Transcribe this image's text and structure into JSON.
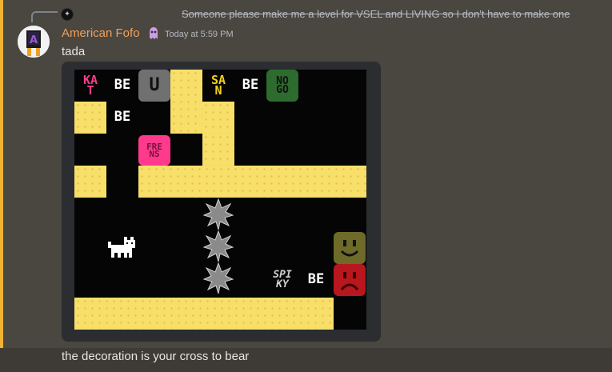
{
  "reply": {
    "text": "Someone please make me a level for VSEL and LIVING so I don't have to make one"
  },
  "message": {
    "author": "American Fofo",
    "timestamp": "Today at 5:59 PM",
    "content": "tada"
  },
  "game": {
    "words": {
      "kat": "KA\nT",
      "be_1": "BE",
      "u": "U",
      "san": "SA\nN",
      "be_2": "BE",
      "nogo": "NO\nGO",
      "be_3": "BE",
      "frens": "FRE\nNS",
      "spiky": "SPI\nKY",
      "be_4": "BE"
    }
  },
  "next_message": {
    "content": "the decoration is your cross to bear"
  },
  "colors": {
    "highlight": "#f0b232",
    "username": "#f0a15a",
    "sand": "#f7df6a",
    "kat": "#ff3a8c",
    "nogo": "#2e6b2e",
    "u_block": "#707070",
    "frens": "#ff3a8c",
    "happy_face": "#6e6a2a",
    "sad_face": "#b8171d"
  }
}
